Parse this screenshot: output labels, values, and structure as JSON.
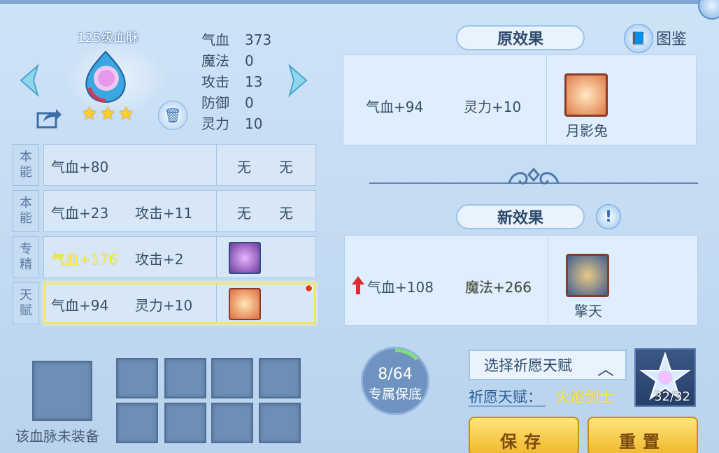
{
  "bloodline": {
    "title": "125级血脉",
    "stars": 3,
    "stats": [
      {
        "k": "气血",
        "v": "373"
      },
      {
        "k": "魔法",
        "v": "0"
      },
      {
        "k": "攻击",
        "v": "13"
      },
      {
        "k": "防御",
        "v": "0"
      },
      {
        "k": "灵力",
        "v": "10"
      }
    ]
  },
  "table": [
    {
      "tag1": "本",
      "tag2": "能",
      "a": "气血+80",
      "b": "",
      "c": "无",
      "d": "无",
      "a_yellow": false
    },
    {
      "tag1": "本",
      "tag2": "能",
      "a": "气血+23",
      "b": "攻击+11",
      "c": "无",
      "d": "无",
      "a_yellow": false
    },
    {
      "tag1": "专",
      "tag2": "精",
      "a": "气血+176",
      "b": "攻击+2",
      "c": "",
      "d": "",
      "a_yellow": true,
      "icon": "crystal-icon"
    },
    {
      "tag1": "天",
      "tag2": "赋",
      "a": "气血+94",
      "b": "灵力+10",
      "c": "",
      "d": "",
      "a_yellow": false,
      "icon": "rabbit-avatar-icon",
      "selected": true
    }
  ],
  "unequipped_label": "该血脉未装备",
  "original": {
    "title": "原效果",
    "stat1": "气血+94",
    "stat2": "灵力+10",
    "icon_name": "月影兔"
  },
  "atlas_label": "图鉴",
  "new_effect": {
    "title": "新效果",
    "stat1": "气血+108",
    "stat2": "魔法+266",
    "icon_name": "擎天"
  },
  "guarantee": {
    "count": "8/64",
    "label": "专属保底",
    "progress": 0.125
  },
  "wish_select_label": "选择祈愿天赋",
  "wish_label": "祈愿天赋：",
  "wish_value": "火焰剑士",
  "crystal_count": "32/32",
  "buttons": {
    "save": "保存",
    "reset": "重置"
  },
  "colors": {
    "yellow_text": "#fff24a",
    "panel_bg": "#dfeefc",
    "button_gold": "#f0b82c"
  }
}
